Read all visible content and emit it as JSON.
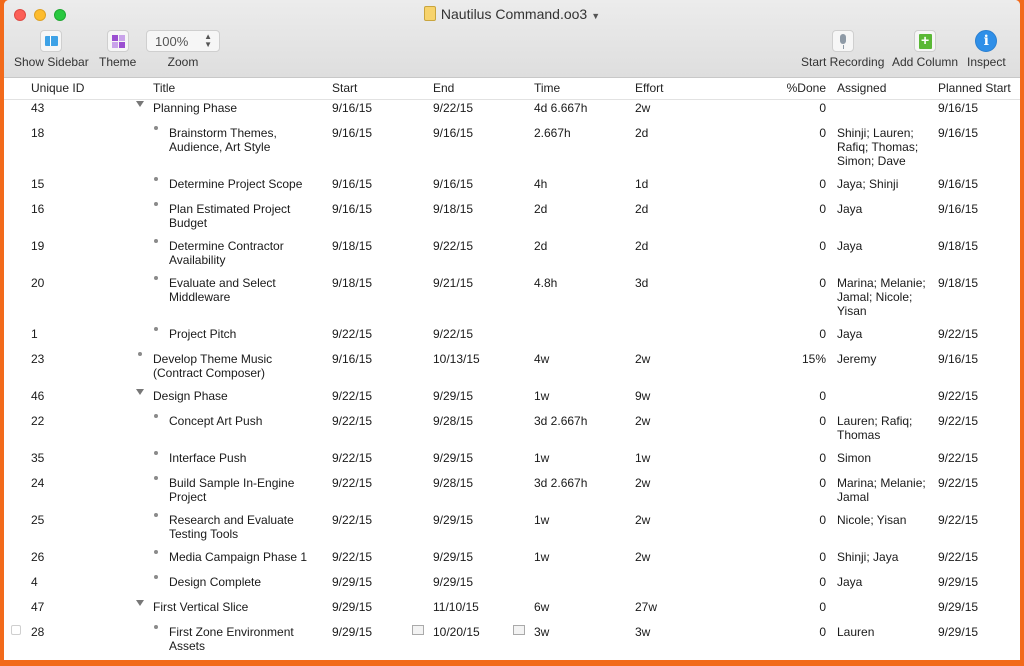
{
  "window": {
    "title": "Nautilus Command.oo3"
  },
  "toolbar": {
    "show_sidebar": "Show Sidebar",
    "theme": "Theme",
    "zoom_value": "100%",
    "zoom_label": "Zoom",
    "start_recording": "Start Recording",
    "add_column": "Add Column",
    "inspect": "Inspect"
  },
  "columns": {
    "id": "Unique ID",
    "title": "Title",
    "start": "Start",
    "end": "End",
    "time": "Time",
    "effort": "Effort",
    "done": "%Done",
    "assigned": "Assigned",
    "planned_start": "Planned Start"
  },
  "rows": [
    {
      "id": "43",
      "title": "Planning Phase",
      "start": "9/16/15",
      "end": "9/22/15",
      "time": "4d 6.667h",
      "effort": "2w",
      "done": "0",
      "assigned": "",
      "planned_start": "9/16/15"
    },
    {
      "id": "18",
      "title": "Brainstorm Themes, Audience, Art Style",
      "start": "9/16/15",
      "end": "9/16/15",
      "time": "2.667h",
      "effort": "2d",
      "done": "0",
      "assigned": "Shinji; Lauren; Rafiq; Thomas; Simon; Dave",
      "planned_start": "9/16/15"
    },
    {
      "id": "15",
      "title": "Determine Project Scope",
      "start": "9/16/15",
      "end": "9/16/15",
      "time": "4h",
      "effort": "1d",
      "done": "0",
      "assigned": "Jaya; Shinji",
      "planned_start": "9/16/15"
    },
    {
      "id": "16",
      "title": "Plan Estimated Project Budget",
      "start": "9/16/15",
      "end": "9/18/15",
      "time": "2d",
      "effort": "2d",
      "done": "0",
      "assigned": "Jaya",
      "planned_start": "9/16/15"
    },
    {
      "id": "19",
      "title": "Determine Contractor Availability",
      "start": "9/18/15",
      "end": "9/22/15",
      "time": "2d",
      "effort": "2d",
      "done": "0",
      "assigned": "Jaya",
      "planned_start": "9/18/15"
    },
    {
      "id": "20",
      "title": "Evaluate and Select Middleware",
      "start": "9/18/15",
      "end": "9/21/15",
      "time": "4.8h",
      "effort": "3d",
      "done": "0",
      "assigned": "Marina; Melanie; Jamal; Nicole; Yisan",
      "planned_start": "9/18/15"
    },
    {
      "id": "1",
      "title": "Project Pitch",
      "start": "9/22/15",
      "end": "9/22/15",
      "time": "",
      "effort": "",
      "done": "0",
      "assigned": "Jaya",
      "planned_start": "9/22/15"
    },
    {
      "id": "23",
      "title": "Develop Theme Music (Contract Composer)",
      "start": "9/16/15",
      "end": "10/13/15",
      "time": "4w",
      "effort": "2w",
      "done": "15%",
      "assigned": "Jeremy",
      "planned_start": "9/16/15"
    },
    {
      "id": "46",
      "title": "Design Phase",
      "start": "9/22/15",
      "end": "9/29/15",
      "time": "1w",
      "effort": "9w",
      "done": "0",
      "assigned": "",
      "planned_start": "9/22/15"
    },
    {
      "id": "22",
      "title": "Concept Art Push",
      "start": "9/22/15",
      "end": "9/28/15",
      "time": "3d 2.667h",
      "effort": "2w",
      "done": "0",
      "assigned": "Lauren; Rafiq; Thomas",
      "planned_start": "9/22/15"
    },
    {
      "id": "35",
      "title": "Interface Push",
      "start": "9/22/15",
      "end": "9/29/15",
      "time": "1w",
      "effort": "1w",
      "done": "0",
      "assigned": "Simon",
      "planned_start": "9/22/15"
    },
    {
      "id": "24",
      "title": "Build Sample In-Engine Project",
      "start": "9/22/15",
      "end": "9/28/15",
      "time": "3d 2.667h",
      "effort": "2w",
      "done": "0",
      "assigned": "Marina; Melanie; Jamal",
      "planned_start": "9/22/15"
    },
    {
      "id": "25",
      "title": "Research and Evaluate Testing Tools",
      "start": "9/22/15",
      "end": "9/29/15",
      "time": "1w",
      "effort": "2w",
      "done": "0",
      "assigned": "Nicole; Yisan",
      "planned_start": "9/22/15"
    },
    {
      "id": "26",
      "title": "Media Campaign Phase 1",
      "start": "9/22/15",
      "end": "9/29/15",
      "time": "1w",
      "effort": "2w",
      "done": "0",
      "assigned": "Shinji; Jaya",
      "planned_start": "9/22/15"
    },
    {
      "id": "4",
      "title": "Design Complete",
      "start": "9/29/15",
      "end": "9/29/15",
      "time": "",
      "effort": "",
      "done": "0",
      "assigned": "Jaya",
      "planned_start": "9/29/15"
    },
    {
      "id": "47",
      "title": "First Vertical Slice",
      "start": "9/29/15",
      "end": "11/10/15",
      "time": "6w",
      "effort": "27w",
      "done": "0",
      "assigned": "",
      "planned_start": "9/29/15"
    },
    {
      "id": "28",
      "title": "First Zone Environment Assets",
      "start": "9/29/15",
      "end": "10/20/15",
      "time": "3w",
      "effort": "3w",
      "done": "0",
      "assigned": "Lauren",
      "planned_start": "9/29/15"
    }
  ]
}
